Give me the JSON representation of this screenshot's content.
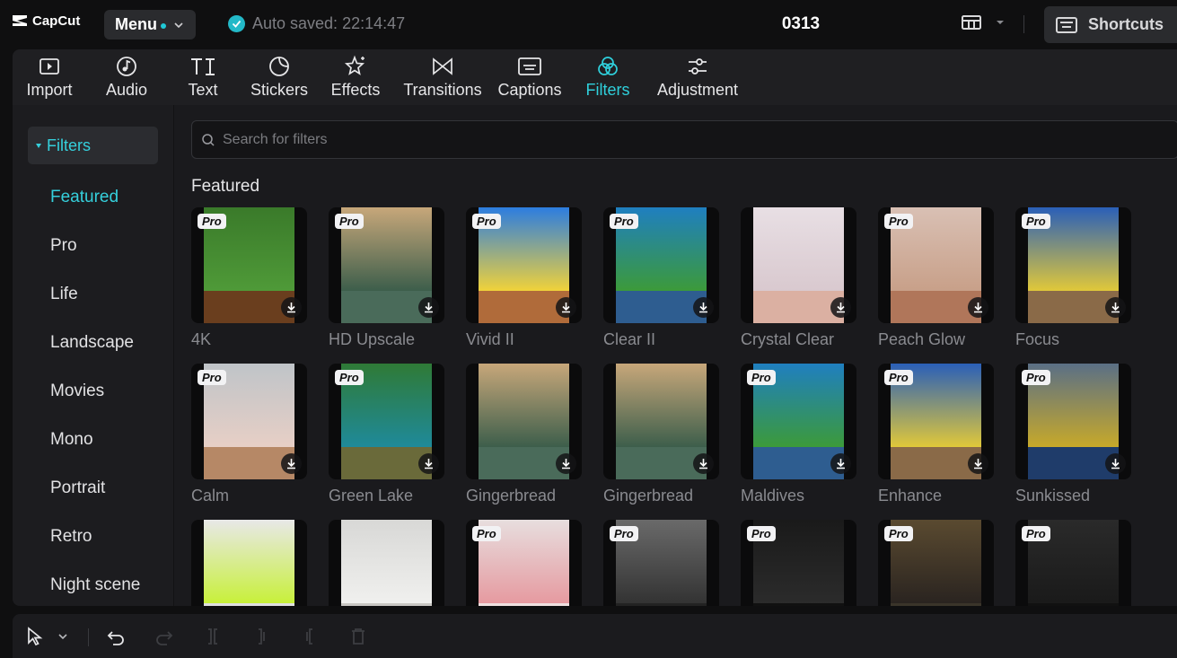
{
  "app": {
    "name": "CapCut",
    "project_name": "0313"
  },
  "header": {
    "menu_label": "Menu",
    "autosave_text": "Auto saved: 22:14:47",
    "shortcuts_label": "Shortcuts"
  },
  "toolbar": {
    "tabs": [
      {
        "label": "Import",
        "icon": "import-icon"
      },
      {
        "label": "Audio",
        "icon": "audio-icon"
      },
      {
        "label": "Text",
        "icon": "text-icon"
      },
      {
        "label": "Stickers",
        "icon": "stickers-icon"
      },
      {
        "label": "Effects",
        "icon": "effects-icon"
      },
      {
        "label": "Transitions",
        "icon": "transitions-icon"
      },
      {
        "label": "Captions",
        "icon": "captions-icon"
      },
      {
        "label": "Filters",
        "icon": "filters-icon",
        "active": true
      },
      {
        "label": "Adjustment",
        "icon": "adjustment-icon"
      }
    ]
  },
  "sidebar": {
    "header": "Filters",
    "items": [
      "Featured",
      "Pro",
      "Life",
      "Landscape",
      "Movies",
      "Mono",
      "Portrait",
      "Retro",
      "Night scene"
    ],
    "active": "Featured"
  },
  "search": {
    "placeholder": "Search for filters"
  },
  "section": {
    "title": "Featured"
  },
  "filters": [
    {
      "label": "4K",
      "pro": true,
      "download": true
    },
    {
      "label": "HD Upscale",
      "pro": true,
      "download": true
    },
    {
      "label": "Vivid II",
      "pro": true,
      "download": true
    },
    {
      "label": "Clear II",
      "pro": true,
      "download": true
    },
    {
      "label": "Crystal Clear",
      "pro": false,
      "download": true
    },
    {
      "label": "Peach Glow",
      "pro": true,
      "download": true
    },
    {
      "label": "Focus",
      "pro": true,
      "download": true
    },
    {
      "label": "Calm",
      "pro": true,
      "download": true
    },
    {
      "label": "Green Lake",
      "pro": true,
      "download": true
    },
    {
      "label": "Gingerbread",
      "pro": false,
      "download": true
    },
    {
      "label": "Gingerbread",
      "pro": false,
      "download": true
    },
    {
      "label": "Maldives",
      "pro": true,
      "download": true
    },
    {
      "label": "Enhance",
      "pro": true,
      "download": true
    },
    {
      "label": "Sunkissed",
      "pro": true,
      "download": true
    },
    {
      "label": "",
      "pro": false,
      "download": false
    },
    {
      "label": "",
      "pro": false,
      "download": false
    },
    {
      "label": "",
      "pro": true,
      "download": false
    },
    {
      "label": "",
      "pro": true,
      "download": false
    },
    {
      "label": "",
      "pro": true,
      "download": false
    },
    {
      "label": "",
      "pro": true,
      "download": false
    },
    {
      "label": "",
      "pro": true,
      "download": false
    }
  ],
  "pro_badge": "Pro",
  "colors": {
    "accent": "#2fd0dc",
    "background": "#0f0f10",
    "panel": "#1b1b1e"
  }
}
